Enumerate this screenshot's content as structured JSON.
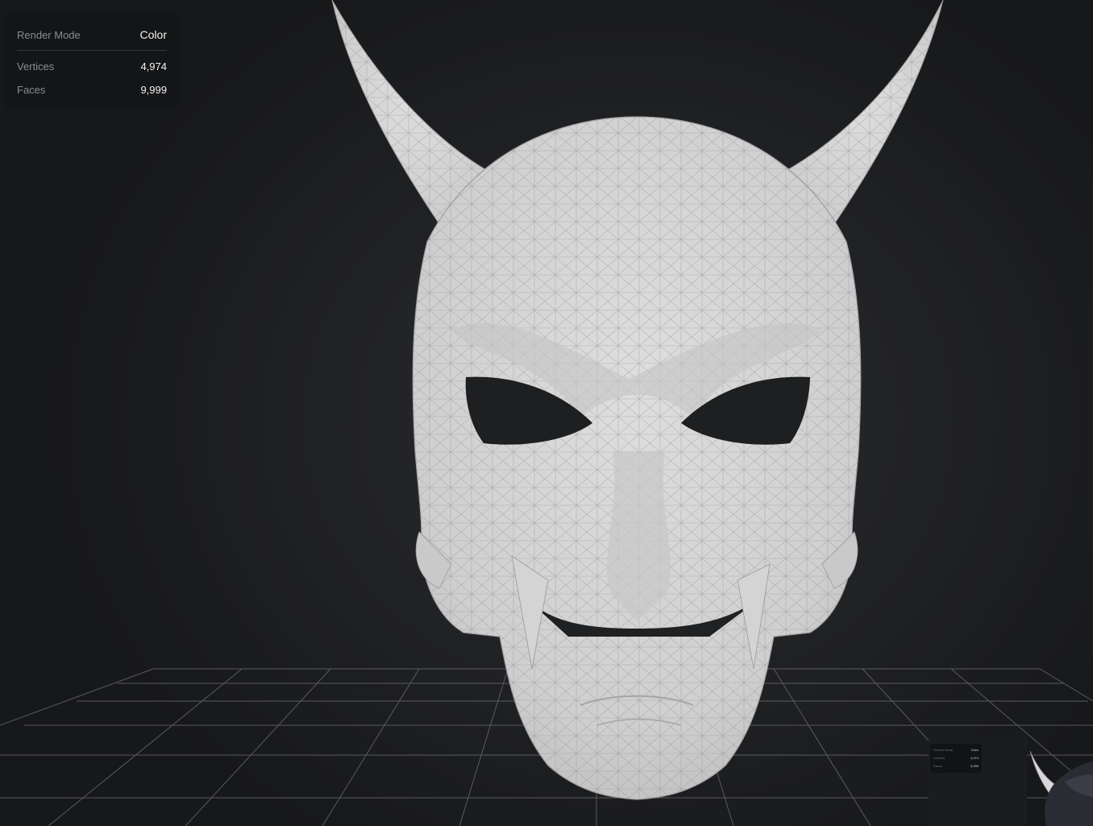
{
  "stats": {
    "render_mode_label": "Render Mode",
    "render_mode_value": "Color",
    "vertices_label": "Vertices",
    "vertices_value": "4,974",
    "faces_label": "Faces",
    "faces_value": "9,999"
  },
  "thumbnail": {
    "render_mode_label": "Render Mode",
    "render_mode_value": "Color",
    "vertices_label": "Vertices",
    "vertices_value": "4,974",
    "faces_label": "Faces",
    "faces_value": "9,999"
  },
  "scene": {
    "model": "oni-mask",
    "grid": true,
    "colors": {
      "background": "#1a1b1d",
      "mesh_fill": "#d2d2d2",
      "wireframe": "#8e8e8e",
      "grid_line": "#6a6a6a"
    }
  }
}
